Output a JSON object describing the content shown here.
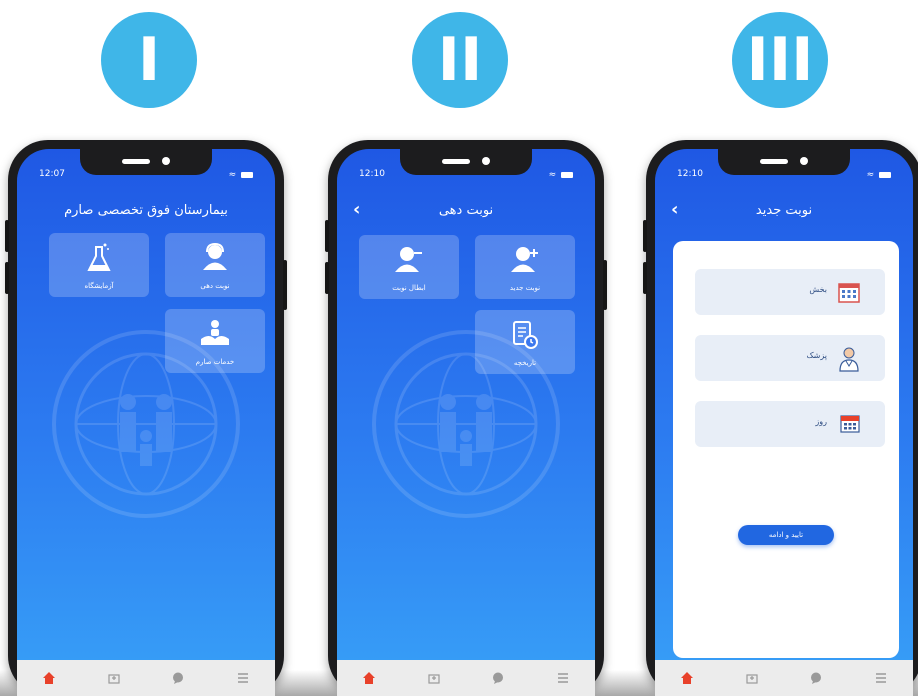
{
  "steps": [
    "I",
    "II",
    "III"
  ],
  "colors": {
    "badge": "#3fb6e8",
    "screen_top": "#1f58e4",
    "screen_bottom": "#38a1f7",
    "home_active": "#e8412a",
    "button": "#2167e1"
  },
  "screen1": {
    "time": "12:07",
    "title": "بیمارستان فوق تخصصی صارم",
    "tiles": [
      {
        "label": "آزمایشگاه",
        "icon": "flask-icon"
      },
      {
        "label": "نوبت دهی",
        "icon": "operator-icon"
      },
      {
        "label": "خدمات صارم",
        "icon": "care-hands-icon"
      }
    ]
  },
  "screen2": {
    "time": "12:10",
    "title": "نوبت دهی",
    "tiles": [
      {
        "label": "ابطال نوبت",
        "icon": "user-minus-icon"
      },
      {
        "label": "نوبت جدید",
        "icon": "user-plus-icon"
      },
      {
        "label": "تاریخچه",
        "icon": "history-doc-icon"
      }
    ]
  },
  "screen3": {
    "time": "12:10",
    "title": "نوبت جدید",
    "fields": [
      {
        "label": "بخش",
        "icon": "building-icon"
      },
      {
        "label": "پزشک",
        "icon": "doctor-icon"
      },
      {
        "label": "روز",
        "icon": "calendar-icon"
      }
    ],
    "confirm": "تایید و ادامه"
  },
  "tabbar": [
    "home-icon",
    "hospital-icon",
    "chat-icon",
    "menu-icon"
  ]
}
